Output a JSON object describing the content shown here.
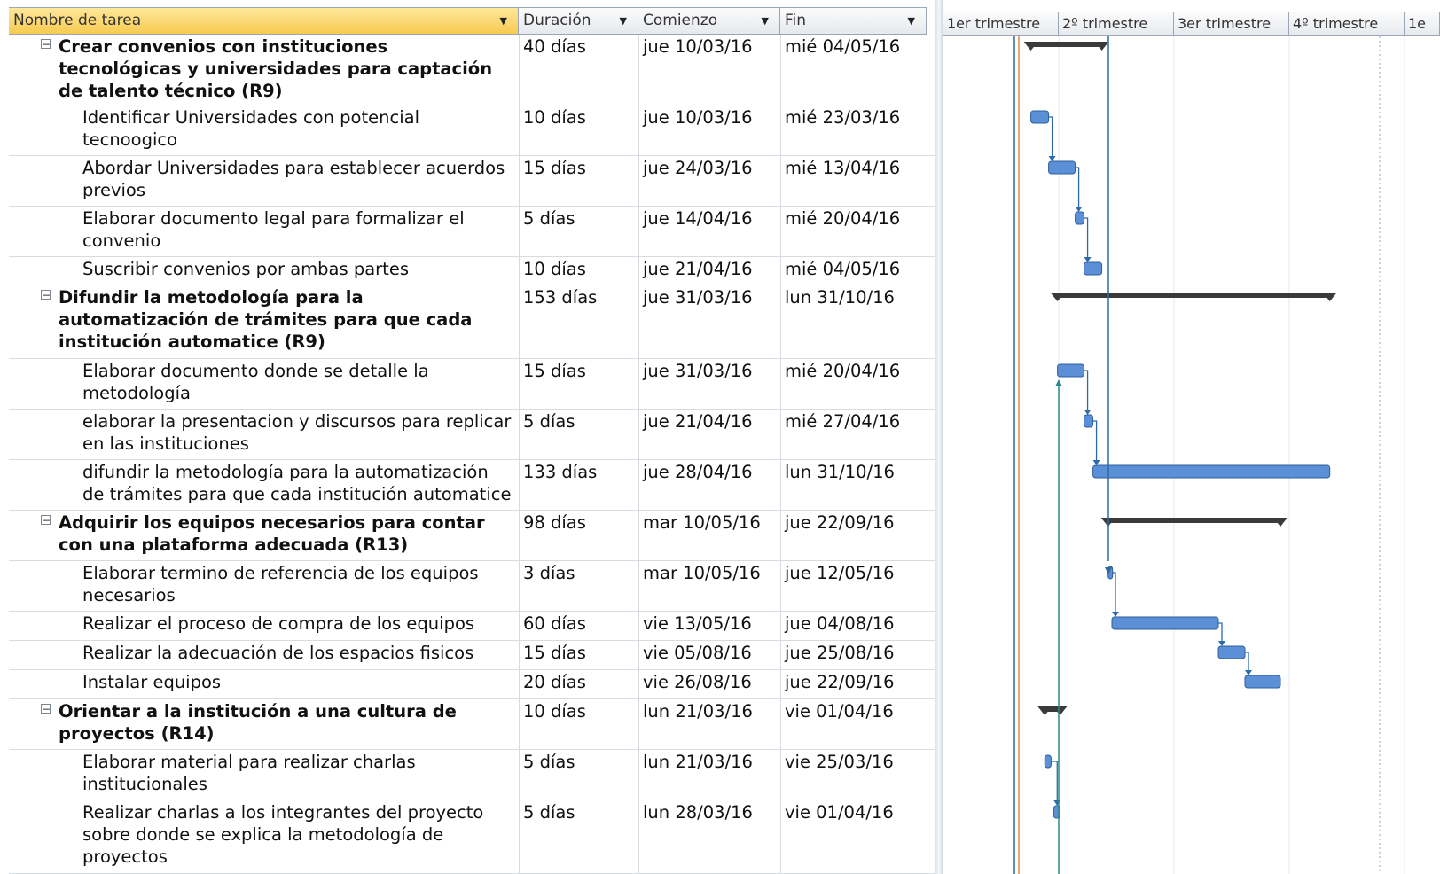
{
  "columns": {
    "name": "Nombre de tarea",
    "duration": "Duración",
    "start": "Comienzo",
    "finish": "Fin"
  },
  "timescale": [
    "1er trimestre",
    "2º trimestre",
    "3er trimestre",
    "4º trimestre",
    "1e"
  ],
  "colors": {
    "header_selected": "#f8cb51",
    "task_bar": "#5b8fd6",
    "summary_bar": "#3a3a3a",
    "link": "#2e6aa8",
    "today_line": "#e8894a",
    "status_line": "#2f6b9a",
    "deadline_line": "#2a8a8a"
  },
  "tasks": [
    {
      "name": "Crear convenios con instituciones tecnológicas y universidades para captación de talento técnico (R9)",
      "summary": true,
      "duration": "40 días",
      "start": "jue 10/03/16",
      "finish": "mié 04/05/16"
    },
    {
      "name": "Identificar Universidades con potencial tecnoogico",
      "summary": false,
      "duration": "10 días",
      "start": "jue 10/03/16",
      "finish": "mié 23/03/16"
    },
    {
      "name": "Abordar Universidades para establecer acuerdos previos",
      "summary": false,
      "duration": "15 días",
      "start": "jue 24/03/16",
      "finish": "mié 13/04/16"
    },
    {
      "name": "Elaborar documento legal para formalizar el convenio",
      "summary": false,
      "duration": "5 días",
      "start": "jue 14/04/16",
      "finish": "mié 20/04/16"
    },
    {
      "name": "Suscribir convenios por ambas partes",
      "summary": false,
      "duration": "10 días",
      "start": "jue 21/04/16",
      "finish": "mié 04/05/16"
    },
    {
      "name": "Difundir la metodología para la automatización de trámites para que cada institución automatice (R9)",
      "summary": true,
      "duration": "153 días",
      "start": "jue 31/03/16",
      "finish": "lun 31/10/16"
    },
    {
      "name": "Elaborar documento donde se detalle la metodología",
      "summary": false,
      "duration": "15 días",
      "start": "jue 31/03/16",
      "finish": "mié 20/04/16"
    },
    {
      "name": "elaborar la presentacion y discursos para replicar en las instituciones",
      "summary": false,
      "duration": "5 días",
      "start": "jue 21/04/16",
      "finish": "mié 27/04/16"
    },
    {
      "name": "difundir la metodología para la automatización de trámites para que cada institución automatice",
      "summary": false,
      "duration": "133 días",
      "start": "jue 28/04/16",
      "finish": "lun 31/10/16"
    },
    {
      "name": "Adquirir los equipos necesarios para contar con una plataforma adecuada (R13)",
      "summary": true,
      "duration": "98 días",
      "start": "mar 10/05/16",
      "finish": "jue 22/09/16"
    },
    {
      "name": "Elaborar termino de referencia de los equipos necesarios",
      "summary": false,
      "duration": "3 días",
      "start": "mar 10/05/16",
      "finish": "jue 12/05/16"
    },
    {
      "name": "Realizar el proceso de compra de los equipos",
      "summary": false,
      "duration": "60 días",
      "start": "vie 13/05/16",
      "finish": "jue 04/08/16"
    },
    {
      "name": "Realizar la adecuación de los espacios fisicos",
      "summary": false,
      "duration": "15 días",
      "start": "vie 05/08/16",
      "finish": "jue 25/08/16"
    },
    {
      "name": "Instalar equipos",
      "summary": false,
      "duration": "20 días",
      "start": "vie 26/08/16",
      "finish": "jue 22/09/16"
    },
    {
      "name": "Orientar a la institución a una cultura de proyectos (R14)",
      "summary": true,
      "duration": "10 días",
      "start": "lun 21/03/16",
      "finish": "vie 01/04/16"
    },
    {
      "name": "Elaborar material para realizar charlas institucionales",
      "summary": false,
      "duration": "5 días",
      "start": "lun 21/03/16",
      "finish": "vie 25/03/16"
    },
    {
      "name": "Realizar charlas a los integrantes del proyecto sobre donde se explica la metodología de proyectos",
      "summary": false,
      "duration": "5 días",
      "start": "lun 28/03/16",
      "finish": "vie 01/04/16"
    }
  ]
}
